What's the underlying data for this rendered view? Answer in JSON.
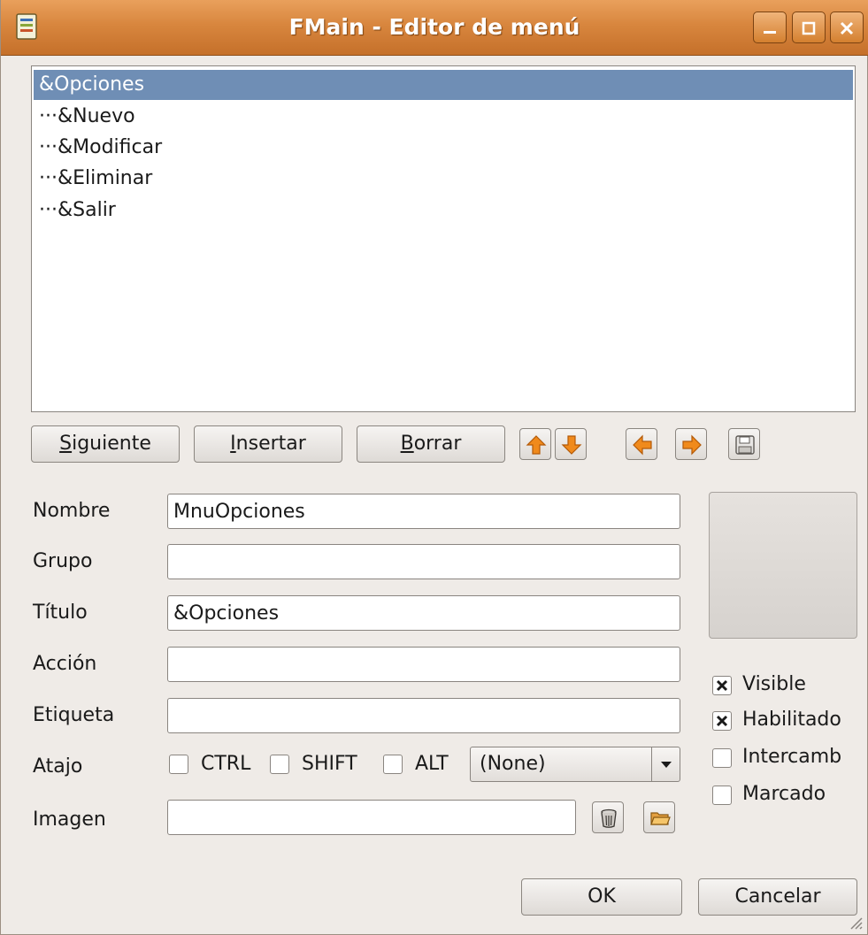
{
  "window": {
    "title": "FMain - Editor de menú"
  },
  "menu_tree": [
    {
      "label": "&Opciones",
      "selected": true
    },
    {
      "label": "···&Nuevo",
      "selected": false
    },
    {
      "label": "···&Modificar",
      "selected": false
    },
    {
      "label": "···&Eliminar",
      "selected": false
    },
    {
      "label": "···&Salir",
      "selected": false
    }
  ],
  "toolbar": {
    "next_mnemonic": "S",
    "next_rest": "iguiente",
    "insert_mnemonic": "I",
    "insert_rest": "nsertar",
    "delete_mnemonic": "B",
    "delete_rest": "orrar",
    "icons": [
      "arrow-up-icon",
      "arrow-down-icon",
      "arrow-left-icon",
      "arrow-right-icon",
      "save-icon"
    ]
  },
  "form": {
    "name_label": "Nombre",
    "name_value": "MnuOpciones",
    "group_label": "Grupo",
    "group_value": "",
    "title_label": "Título",
    "title_value": "&Opciones",
    "action_label": "Acción",
    "action_value": "",
    "tag_label": "Etiqueta",
    "tag_value": "",
    "shortcut_label": "Atajo",
    "ctrl_label": "CTRL",
    "ctrl_checked": false,
    "shift_label": "SHIFT",
    "shift_checked": false,
    "alt_label": "ALT",
    "alt_checked": false,
    "key_value": "(None)",
    "image_label": "Imagen",
    "image_value": ""
  },
  "options": {
    "visible_label": "Visible",
    "visible_checked": true,
    "enabled_label": "Habilitado",
    "enabled_checked": true,
    "toggle_label": "Intercamb",
    "toggle_checked": false,
    "checked_label": "Marcado",
    "checked_checked": false
  },
  "dialog": {
    "ok_label": "OK",
    "cancel_label": "Cancelar"
  },
  "colors": {
    "titlebar": "#d8863e",
    "selection": "#6f8eb5",
    "arrow_orange": "#f08a1c"
  }
}
